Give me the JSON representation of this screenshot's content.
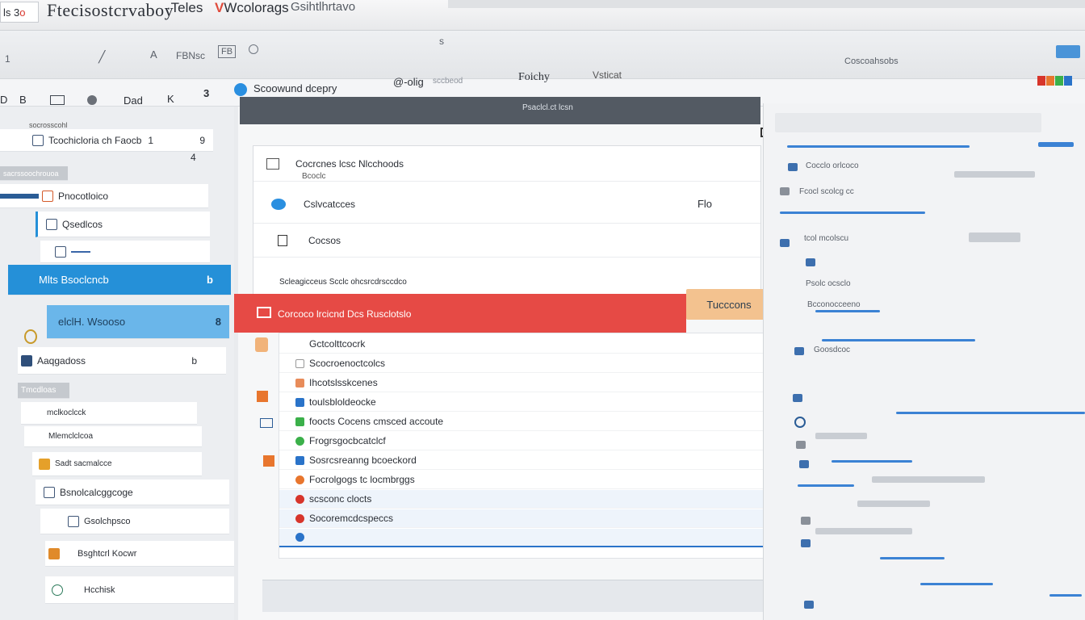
{
  "window": {
    "badge": "ls 3",
    "badge_red": "o",
    "title": "Ftecisostcrvaboy",
    "tab1": "·Teles",
    "tab2_prefix": "V",
    "tab2": "Wcolorags",
    "tab3": "Gsihtlhrtavo"
  },
  "toolbar": {
    "item1": "1",
    "item2": "A",
    "box_label": "FBNsc",
    "box2": "FB",
    "center_icon": "ѕ",
    "right_label": "Coscoahsobs"
  },
  "nav": {
    "left_items": [
      "D",
      "B",
      "Dad",
      "K",
      "3"
    ],
    "brand": "Scoowund dcepry",
    "search": "@-olig",
    "search_hint": "sccbeod",
    "center_title": "Foichy",
    "verified": "Vsticat",
    "colors": [
      "#d7352b",
      "#e8762e",
      "#3bb04a",
      "#2a73c9"
    ]
  },
  "sidebar": {
    "header": "socrosscohl",
    "rows": [
      {
        "label": "Tcochicloria ch Faocb",
        "count": "1",
        "side": "9"
      },
      {
        "label": "sacrssoochrouoa",
        "side": "4"
      },
      {
        "label": "Pnocotloico"
      },
      {
        "label": "Qsedlcos"
      },
      {
        "label": "Mlts Bsoclcncb",
        "side": "b"
      },
      {
        "label": "elclH. Wsooso",
        "side": "8"
      },
      {
        "label": "Aaqgadoss",
        "side": "b"
      },
      {
        "label": "Tmcdloas"
      },
      {
        "label": "mclkoclcck"
      },
      {
        "label": "Mlemclclcoa"
      },
      {
        "label": "Sadt sacmalcce"
      },
      {
        "label": "Bsnolcalcggcoge"
      },
      {
        "label": "Gsolchpsco"
      },
      {
        "label": "Bsghtcrl Kocwr"
      },
      {
        "label": "Hcchisk"
      }
    ]
  },
  "center": {
    "header": "Psaclcl.ct lcsn",
    "card_top": "Cocrcnes lcsc Nlcchoods",
    "card_top_sub": "Bcoclc",
    "card_row2": "Cslvcatcces",
    "card_row3": "Cocsos",
    "card_footer": "Scleagicceus Scclc ohcsrcdrsccdco",
    "card_side": "Flo",
    "redbar": "Corcoco lrcicnd Dcs Rusclotslo",
    "orange_btn": "Tucccons",
    "list": [
      "Gctcolttcocrk",
      "Scocroenoctcolcs",
      "Ihcotslsskcenes",
      "toulsbloldeocke",
      "foocts Cocens cmsced accoute",
      "Frogrsgocbcatclcf",
      "Sosrcsreanng bcoeckord",
      "Focrolgogs tc locmbrggs",
      "scsconc clocts",
      "Socoremcdcspeccs",
      ""
    ]
  },
  "right": {
    "rows": [
      "Cocclo orlcoco",
      "Fcocl scolcg cc",
      "tcol mcolscu",
      "Psolc ocsclo",
      "Bcconocceeno",
      "Goosdcoc"
    ]
  }
}
